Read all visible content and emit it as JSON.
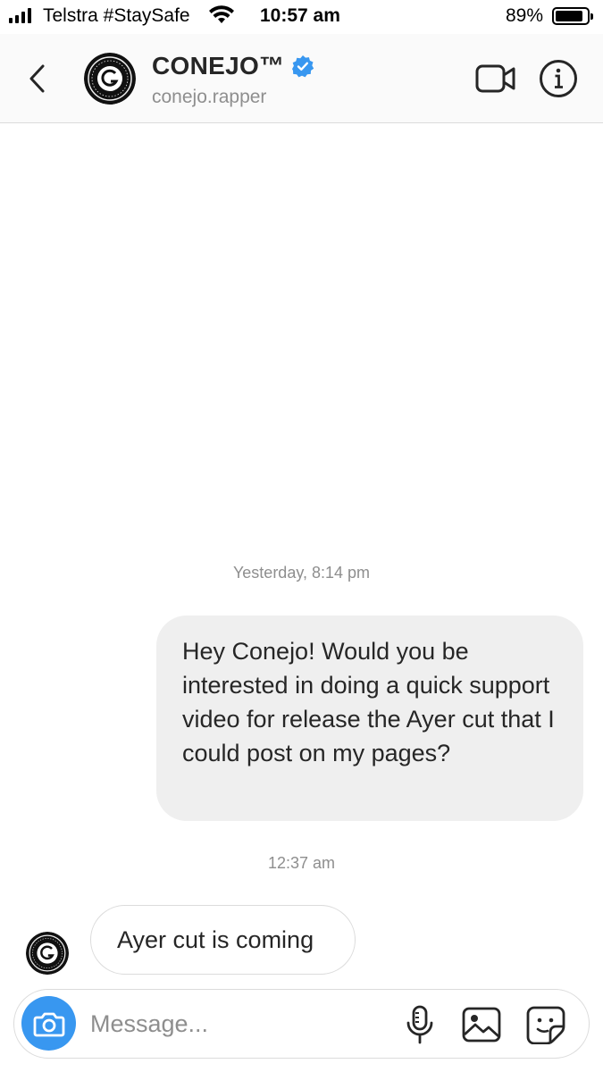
{
  "status_bar": {
    "carrier": "Telstra #StaySafe",
    "time": "10:57 am",
    "battery": "89%",
    "battery_level": 0.89,
    "icons": [
      "signal-icon",
      "wifi-icon",
      "battery-icon"
    ]
  },
  "header": {
    "display_name": "CONEJO™",
    "username": "conejo.rapper",
    "verified": true,
    "icons": [
      "back-chevron-icon",
      "verified-badge-icon",
      "video-call-icon",
      "info-icon"
    ]
  },
  "messages": [
    {
      "type": "timestamp",
      "text": "Yesterday, 8:14 pm"
    },
    {
      "type": "sent",
      "text": "Hey Conejo! Would you be interested in doing a quick support video for release the Ayer cut that I could post on my pages?"
    },
    {
      "type": "timestamp",
      "text": "12:37 am"
    },
    {
      "type": "received",
      "text": "Ayer cut is coming"
    }
  ],
  "composer": {
    "placeholder": "Message...",
    "value": "",
    "icons": [
      "camera-icon",
      "microphone-icon",
      "gallery-icon",
      "sticker-icon"
    ]
  },
  "colors": {
    "accent": "#3897f0",
    "verified": "#3897f0",
    "bubble_sent": "#efefef",
    "border": "#dbdbdb",
    "muted_text": "#8e8e8e"
  }
}
